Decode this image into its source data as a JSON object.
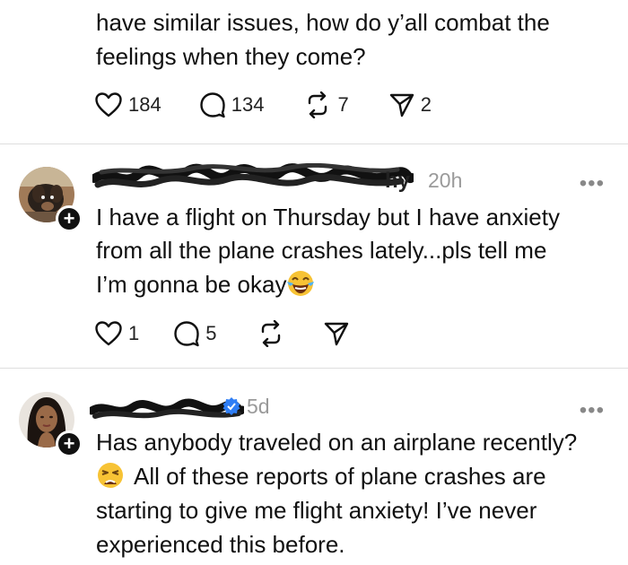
{
  "post1": {
    "lines": [
      "have similar issues, how do y’all combat the",
      "feelings when they come?"
    ],
    "likes": "184",
    "replies": "134",
    "reposts": "7",
    "shares": "2"
  },
  "post2": {
    "handle_tail": "hy",
    "time": "20h",
    "more": "•••",
    "line1": "I have a flight on Thursday but I have anxiety",
    "line2": "from all the plane crashes lately...pls tell me",
    "line3": "I’m gonna be okay",
    "likes": "1",
    "replies": "5"
  },
  "post3": {
    "time": "5d",
    "more": "•••",
    "line1": "Has anybody traveled on an airplane recently?",
    "line2": "All of these reports of plane crashes are",
    "line3": "starting to give me flight anxiety! I’ve never",
    "line4": "experienced this before."
  }
}
